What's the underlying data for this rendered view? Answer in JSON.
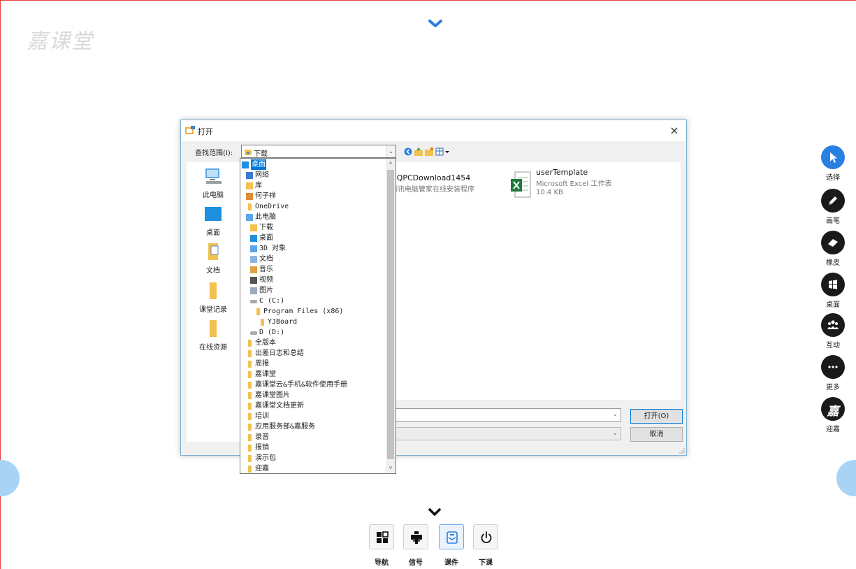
{
  "app": {
    "logo_text": "嘉课堂"
  },
  "right_toolbar": [
    {
      "label": "选择",
      "icon": "cursor-icon",
      "active": true
    },
    {
      "label": "画笔",
      "icon": "pen-icon"
    },
    {
      "label": "橡皮",
      "icon": "eraser-icon"
    },
    {
      "label": "桌面",
      "icon": "windows-icon"
    },
    {
      "label": "互动",
      "icon": "group-icon"
    },
    {
      "label": "更多",
      "icon": "more-icon"
    },
    {
      "label": "迎嘉",
      "icon": "brand-icon",
      "glyph": "嘉"
    }
  ],
  "bottom_toolbar": [
    {
      "label": "导航",
      "icon": "grid-icon"
    },
    {
      "label": "信号",
      "icon": "signal-icon"
    },
    {
      "label": "课件",
      "icon": "courseware-icon",
      "active": true
    },
    {
      "label": "下课",
      "icon": "power-icon"
    }
  ],
  "dialog": {
    "title": "打开",
    "close": "×",
    "look_in_label": "查找范围(I):",
    "look_in_value": "下载",
    "places": [
      "此电脑",
      "桌面",
      "文档",
      "课堂记录",
      "在线资源"
    ],
    "files": [
      {
        "name": "QQPCDownload1454",
        "desc": "腾讯电脑管家在线安装程序",
        "size": ""
      },
      {
        "name": "userTemplate",
        "desc": "Microsoft Excel 工作表",
        "size": "10.4 KB"
      }
    ],
    "open_button": "打开(O)",
    "cancel_button": "取消"
  },
  "look_in_dropdown": [
    {
      "label": "桌面",
      "icon": "desktop-icon",
      "selected": true
    },
    {
      "label": "网络",
      "icon": "network-icon"
    },
    {
      "label": "库",
      "icon": "library-icon"
    },
    {
      "label": "何子祥",
      "icon": "user-folder-icon"
    },
    {
      "label": "OneDrive",
      "icon": "folder-icon"
    },
    {
      "label": "此电脑",
      "icon": "computer-icon"
    },
    {
      "label": "下载",
      "icon": "download-folder-icon"
    },
    {
      "label": "桌面",
      "icon": "desktop-icon"
    },
    {
      "label": "3D 对象",
      "icon": "3d-objects-icon"
    },
    {
      "label": "文档",
      "icon": "documents-icon"
    },
    {
      "label": "音乐",
      "icon": "music-icon"
    },
    {
      "label": "视频",
      "icon": "video-icon"
    },
    {
      "label": "图片",
      "icon": "pictures-icon"
    },
    {
      "label": "C (C:)",
      "icon": "drive-icon"
    },
    {
      "label": "Program Files (x86)",
      "icon": "folder-icon"
    },
    {
      "label": "YJBoard",
      "icon": "folder-icon"
    },
    {
      "label": "D (D:)",
      "icon": "drive-icon"
    },
    {
      "label": "全版本",
      "icon": "folder-icon"
    },
    {
      "label": "出差日志和总结",
      "icon": "folder-icon"
    },
    {
      "label": "周报",
      "icon": "folder-icon"
    },
    {
      "label": "嘉课堂",
      "icon": "folder-icon"
    },
    {
      "label": "嘉课堂云&手机&软件使用手册",
      "icon": "folder-icon"
    },
    {
      "label": "嘉课堂图片",
      "icon": "folder-icon"
    },
    {
      "label": "嘉课堂文档更新",
      "icon": "folder-icon"
    },
    {
      "label": "培训",
      "icon": "folder-icon"
    },
    {
      "label": "应用服务部&嘉服务",
      "icon": "folder-icon"
    },
    {
      "label": "录音",
      "icon": "folder-icon"
    },
    {
      "label": "报销",
      "icon": "folder-icon"
    },
    {
      "label": "演示包",
      "icon": "folder-icon"
    },
    {
      "label": "迎嘉",
      "icon": "folder-icon"
    }
  ],
  "colors": {
    "accent": "#0078d7",
    "folder": "#f2c14e",
    "toolbar_dark": "#1a1a1a",
    "toolbar_active": "#2a80e0",
    "frame_border": "#e34040"
  }
}
